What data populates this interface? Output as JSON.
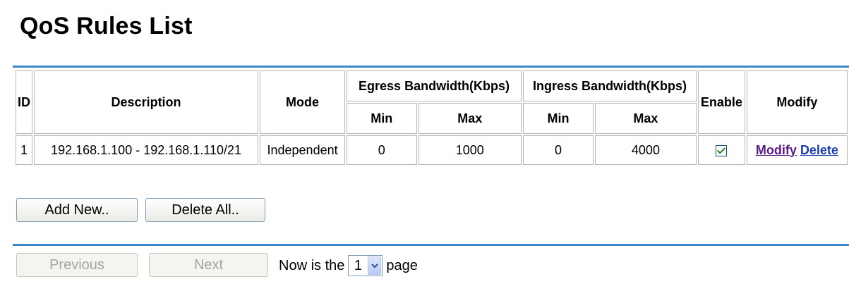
{
  "page": {
    "title": "QoS Rules List"
  },
  "table": {
    "headers": {
      "id": "ID",
      "description": "Description",
      "mode": "Mode",
      "egress": "Egress Bandwidth(Kbps)",
      "ingress": "Ingress Bandwidth(Kbps)",
      "enable": "Enable",
      "modify": "Modify",
      "min": "Min",
      "max": "Max"
    },
    "rows": [
      {
        "id": "1",
        "description": "192.168.1.100 - 192.168.1.110/21",
        "mode": "Independent",
        "egress_min": "0",
        "egress_max": "1000",
        "ingress_min": "0",
        "ingress_max": "4000",
        "enabled": true,
        "modify_label": "Modify",
        "delete_label": "Delete"
      }
    ]
  },
  "actions": {
    "add_new": "Add New..",
    "delete_all": "Delete All.."
  },
  "pagination": {
    "previous": "Previous",
    "next": "Next",
    "prefix": "Now is the",
    "current_page": "1",
    "suffix": "page"
  },
  "colors": {
    "rule": "#3a88c8",
    "modify_link": "#5a1a8a",
    "delete_link": "#1a3fb0",
    "check": "#1b8a1b"
  }
}
